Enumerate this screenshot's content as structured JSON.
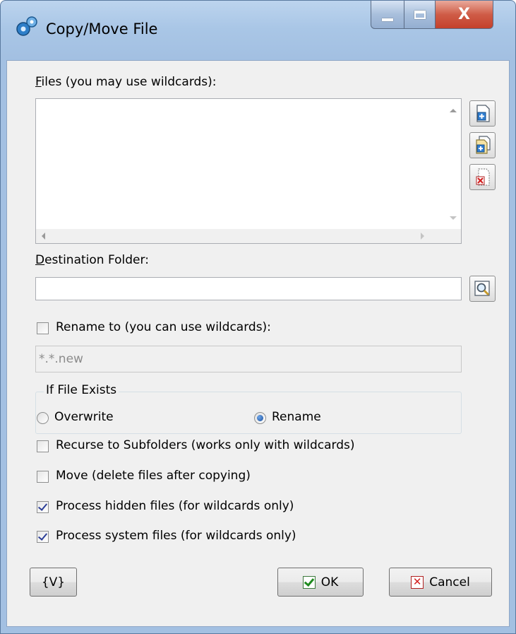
{
  "window": {
    "title": "Copy/Move File",
    "close_glyph": "X"
  },
  "files": {
    "label": "Files (you may use wildcards):",
    "value": ""
  },
  "destination": {
    "label": "Destination Folder:",
    "value": ""
  },
  "rename": {
    "label": "Rename to (you can use wildcards):",
    "checked": false,
    "value": "*.*.new"
  },
  "if_exists": {
    "legend": "If File Exists",
    "overwrite_label": "Overwrite",
    "rename_label": "Rename",
    "selected": "Rename"
  },
  "options": {
    "recurse_label": "Recurse to Subfolders (works only with wildcards)",
    "move_label": "Move (delete files after copying)",
    "hidden_label": "Process hidden files (for wildcards only)",
    "system_label": "Process system files (for wildcards only)"
  },
  "buttons": {
    "variables": "{V}",
    "ok": "OK",
    "cancel": "Cancel"
  },
  "icons": {
    "app": "app-gear-icon",
    "add_file": "add-file-icon",
    "add_folder": "add-folder-icon",
    "remove": "remove-file-icon",
    "browse": "browse-folder-icon"
  }
}
